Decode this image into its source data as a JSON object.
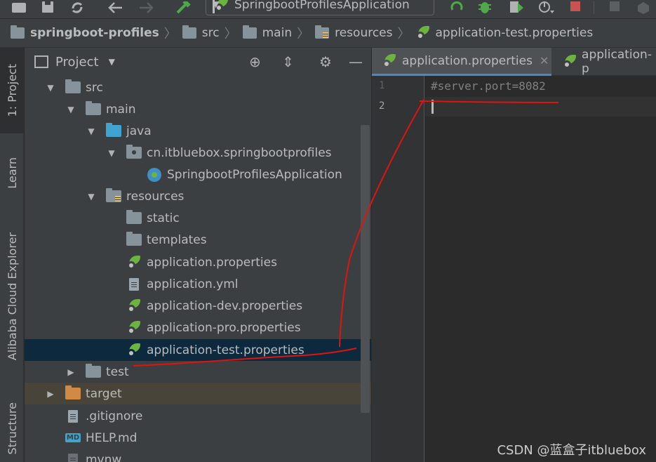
{
  "toolbar": {
    "run_config": "SpringbootProfilesApplication",
    "icons": [
      "folder-open-icon",
      "save-icon",
      "sync-icon",
      "back-icon",
      "forward-icon",
      "build-icon",
      "run-icon",
      "debug-icon",
      "coverage-icon",
      "profile-icon",
      "stop-icon"
    ]
  },
  "breadcrumb": {
    "items": [
      "springboot-profiles",
      "src",
      "main",
      "resources",
      "application-test.properties"
    ]
  },
  "stripe": {
    "tabs": [
      "1: Project",
      "Learn",
      "Alibaba Cloud Explorer",
      "Structure"
    ]
  },
  "project": {
    "title": "Project",
    "tree": [
      {
        "label": "src",
        "expanded": true
      },
      {
        "label": "main",
        "expanded": true
      },
      {
        "label": "java",
        "expanded": true
      },
      {
        "label": "cn.itbluebox.springbootprofiles",
        "expanded": true
      },
      {
        "label": "SpringbootProfilesApplication"
      },
      {
        "label": "resources",
        "expanded": true
      },
      {
        "label": "static"
      },
      {
        "label": "templates"
      },
      {
        "label": "application.properties"
      },
      {
        "label": "application.yml"
      },
      {
        "label": "application-dev.properties"
      },
      {
        "label": "application-pro.properties"
      },
      {
        "label": "application-test.properties",
        "selected": true
      },
      {
        "label": "test",
        "expanded": false
      },
      {
        "label": "target",
        "expanded": false
      },
      {
        "label": ".gitignore"
      },
      {
        "label": "HELP.md"
      },
      {
        "label": "mvnw"
      }
    ]
  },
  "editor": {
    "tabs": [
      {
        "label": "application.properties",
        "active": true
      },
      {
        "label": "application-p"
      }
    ],
    "lines": [
      {
        "number": "1",
        "text": "#server.port=8082"
      },
      {
        "number": "2",
        "text": ""
      }
    ]
  },
  "watermark": "CSDN @蓝盒子itbluebox",
  "colors": {
    "annotation": "#e0140f",
    "selection": "#0d293e",
    "spring_green": "#6db33f"
  }
}
